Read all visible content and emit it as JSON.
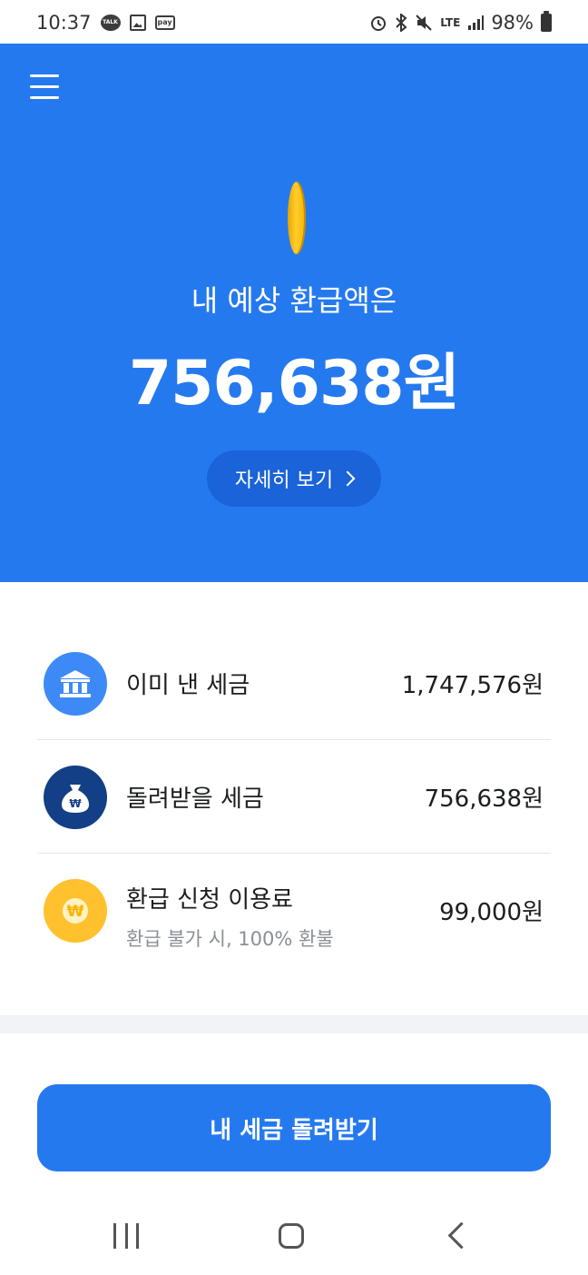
{
  "status_bar": {
    "time": "10:37",
    "talk_badge": "TALK",
    "pay_badge": "pay",
    "network": "LTE",
    "battery": "98%"
  },
  "hero": {
    "subtitle": "내 예상 환급액은",
    "amount": "756,638원",
    "detail_label": "자세히 보기"
  },
  "breakdown": [
    {
      "title": "이미 낸 세금",
      "value": "1,747,576원",
      "icon": "bank-icon",
      "color": "#3d8af7"
    },
    {
      "title": "돌려받을 세금",
      "value": "756,638원",
      "icon": "money-bag-icon",
      "color": "#123f86"
    },
    {
      "title": "환급 신청 이용료",
      "subtitle": "환급 불가 시, 100% 환불",
      "value": "99,000원",
      "icon": "won-coin-icon",
      "color": "#ffc12e"
    }
  ],
  "cta_label": "내 세금 돌려받기",
  "colors": {
    "primary": "#2579ef",
    "primary_dark": "#1a63d8"
  }
}
